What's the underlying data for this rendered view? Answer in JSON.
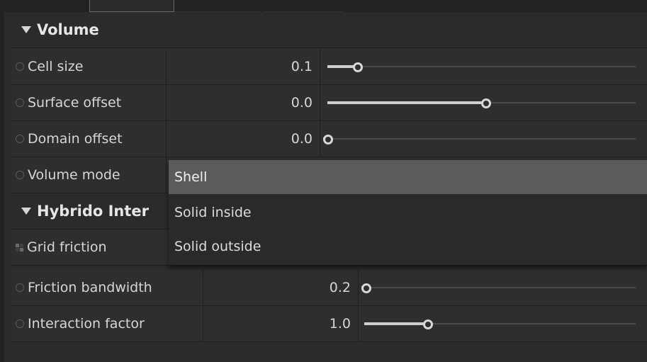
{
  "sections": {
    "volume": {
      "title": "Volume"
    },
    "hybrido": {
      "title": "Hybrido Inter"
    }
  },
  "rows": {
    "cell_size": {
      "label": "Cell size",
      "value": "0.1",
      "level": 0.085
    },
    "surface_offset": {
      "label": "Surface offset",
      "value": "0.0",
      "level": 0.515
    },
    "domain_offset": {
      "label": "Domain offset",
      "value": "0.0",
      "level": 0.0
    },
    "volume_mode": {
      "label": "Volume mode"
    },
    "grid_friction": {
      "label": "Grid friction"
    },
    "friction_bandwidth": {
      "label": "Friction bandwidth",
      "value": "0.2",
      "level": 0.0
    },
    "interaction_factor": {
      "label": "Interaction factor",
      "value": "1.0",
      "level": 0.225
    }
  },
  "dropdown": {
    "options": [
      "Shell",
      "Solid inside",
      "Solid outside"
    ],
    "selected_index": 0
  },
  "icons": {
    "section_toggle": "triangle-down-icon",
    "param_key": "radio-icon",
    "grid_friction": "checkerboard-icon"
  },
  "colors": {
    "panel_bg": "#2e2e2e",
    "highlight": "#5b5b5b",
    "slider_fill": "#cfcfcf"
  }
}
